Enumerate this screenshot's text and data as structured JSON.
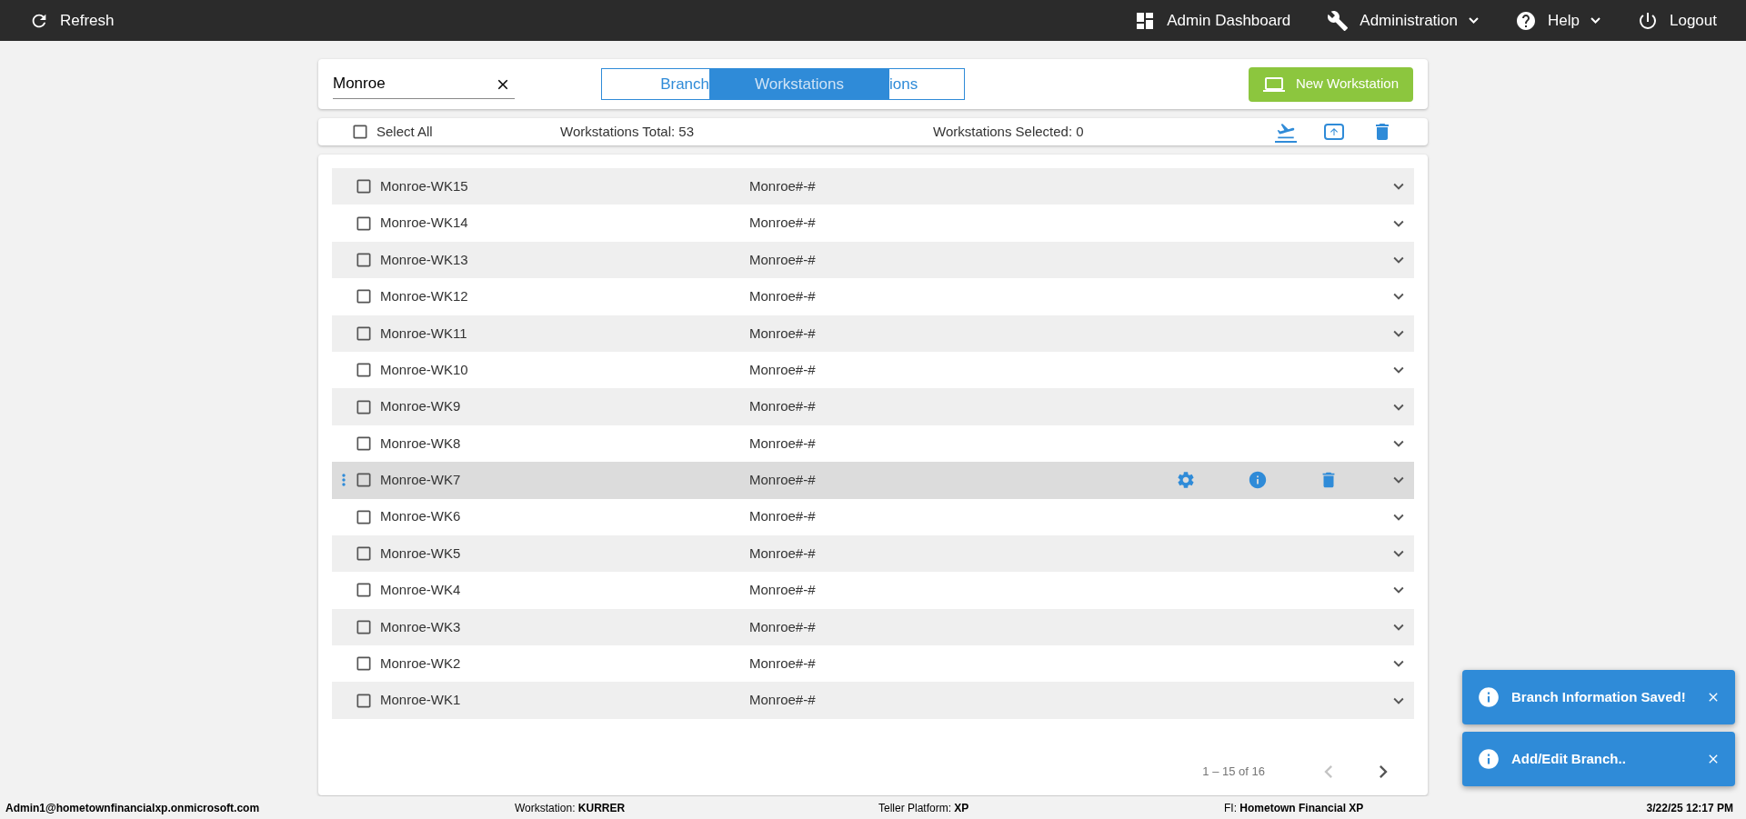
{
  "topbar": {
    "refresh": "Refresh",
    "menu": [
      {
        "kind": "dashboard",
        "label": "Admin Dashboard",
        "dropdown": false
      },
      {
        "kind": "admin",
        "label": "Administration",
        "dropdown": true
      },
      {
        "kind": "help",
        "label": "Help",
        "dropdown": true
      },
      {
        "kind": "logout",
        "label": "Logout",
        "dropdown": false
      }
    ]
  },
  "search": {
    "value": "Monroe"
  },
  "tabs": [
    {
      "label": "Branch",
      "selected": false
    },
    {
      "label": "Workstations",
      "selected": true
    },
    {
      "label": "ions",
      "selected": false
    }
  ],
  "new_button": "New Workstation",
  "toolbar": {
    "select_all": {
      "label": "Select All",
      "checked": false
    },
    "total": "Workstations Total: 53",
    "selected_count": "Workstations Selected: 0"
  },
  "rows": [
    {
      "name": "Monroe-WK15",
      "pattern": "Monroe#-#",
      "checked": false,
      "hovered": false
    },
    {
      "name": "Monroe-WK14",
      "pattern": "Monroe#-#",
      "checked": false,
      "hovered": false
    },
    {
      "name": "Monroe-WK13",
      "pattern": "Monroe#-#",
      "checked": false,
      "hovered": false
    },
    {
      "name": "Monroe-WK12",
      "pattern": "Monroe#-#",
      "checked": false,
      "hovered": false
    },
    {
      "name": "Monroe-WK11",
      "pattern": "Monroe#-#",
      "checked": false,
      "hovered": false
    },
    {
      "name": "Monroe-WK10",
      "pattern": "Monroe#-#",
      "checked": false,
      "hovered": false
    },
    {
      "name": "Monroe-WK9",
      "pattern": "Monroe#-#",
      "checked": false,
      "hovered": false
    },
    {
      "name": "Monroe-WK8",
      "pattern": "Monroe#-#",
      "checked": false,
      "hovered": false
    },
    {
      "name": "Monroe-WK7",
      "pattern": "Monroe#-#",
      "checked": false,
      "hovered": true
    },
    {
      "name": "Monroe-WK6",
      "pattern": "Monroe#-#",
      "checked": false,
      "hovered": false
    },
    {
      "name": "Monroe-WK5",
      "pattern": "Monroe#-#",
      "checked": false,
      "hovered": false
    },
    {
      "name": "Monroe-WK4",
      "pattern": "Monroe#-#",
      "checked": false,
      "hovered": false
    },
    {
      "name": "Monroe-WK3",
      "pattern": "Monroe#-#",
      "checked": false,
      "hovered": false
    },
    {
      "name": "Monroe-WK2",
      "pattern": "Monroe#-#",
      "checked": false,
      "hovered": false
    },
    {
      "name": "Monroe-WK1",
      "pattern": "Monroe#-#",
      "checked": false,
      "hovered": false
    }
  ],
  "pagination": {
    "range": "1 – 15 of 16",
    "prev_disabled": true,
    "next_disabled": false
  },
  "status_bar": [
    "**Admin1@hometownfinancialxp.onmicrosoft.com**",
    "Workstation: **KURRER**",
    "Teller Platform: **XP**",
    "FI: **Hometown Financial XP**",
    "**3/22/25 12:17 PM**"
  ],
  "toasts": [
    {
      "message": "Branch Information Saved!"
    },
    {
      "message": "Add/Edit Branch.."
    }
  ]
}
